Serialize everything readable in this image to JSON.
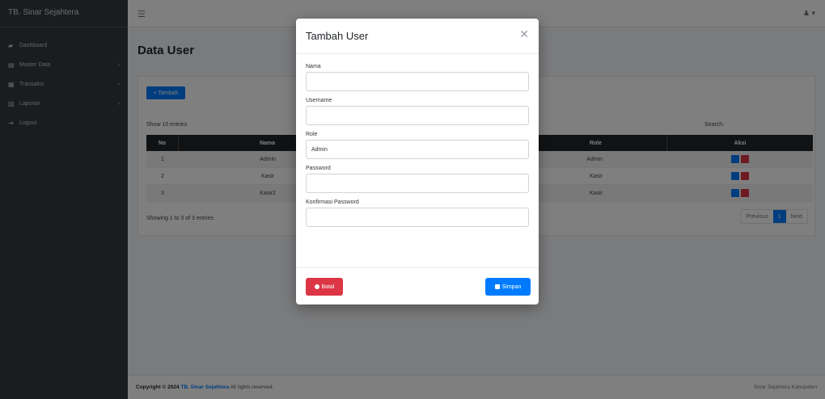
{
  "sidebar": {
    "brand": "TB. Sinar Sejahtera",
    "items": [
      {
        "label": "Dashboard",
        "icon": "dashboard-icon",
        "has_caret": false
      },
      {
        "label": "Master Data",
        "icon": "database-icon",
        "has_caret": true
      },
      {
        "label": "Transaksi",
        "icon": "cart-icon",
        "has_caret": true
      },
      {
        "label": "Laporan",
        "icon": "report-icon",
        "has_caret": true
      },
      {
        "label": "Logout",
        "icon": "logout-icon",
        "has_caret": false
      }
    ]
  },
  "page": {
    "title": "Data User",
    "add_button": "+ Tambah",
    "show_entries": "Show 10 entries",
    "search_label": "Search:",
    "columns": [
      "No",
      "Nama",
      "Role",
      "Aksi"
    ],
    "rows": [
      {
        "no": "1",
        "nama": "Admin",
        "role": "Admin"
      },
      {
        "no": "2",
        "nama": "Kasir",
        "role": "Kasir"
      },
      {
        "no": "3",
        "nama": "Kasir2",
        "role": "Kasir"
      }
    ],
    "info": "Showing 1 to 3 of 3 entries",
    "pager": {
      "prev": "Previous",
      "current": "1",
      "next": "Next"
    }
  },
  "footer": {
    "left_prefix": "Copyright © 2024",
    "left_brand": "TB. Sinar Sejahtera",
    "left_suffix": "All rights reserved.",
    "right": "Sinar Sejahtera Kabupaten"
  },
  "modal": {
    "title": "Tambah User",
    "fields": {
      "nama_label": "Nama",
      "username_label": "Username",
      "role_label": "Role",
      "role_value": "Admin",
      "password_label": "Password",
      "confirm_label": "Konfirmasi Password"
    },
    "batal_label": "Batal",
    "simpan_label": "Simpan"
  },
  "colors": {
    "primary": "#007bff",
    "danger": "#dc3545",
    "sidebar": "#343a40",
    "table_header": "#212529"
  }
}
